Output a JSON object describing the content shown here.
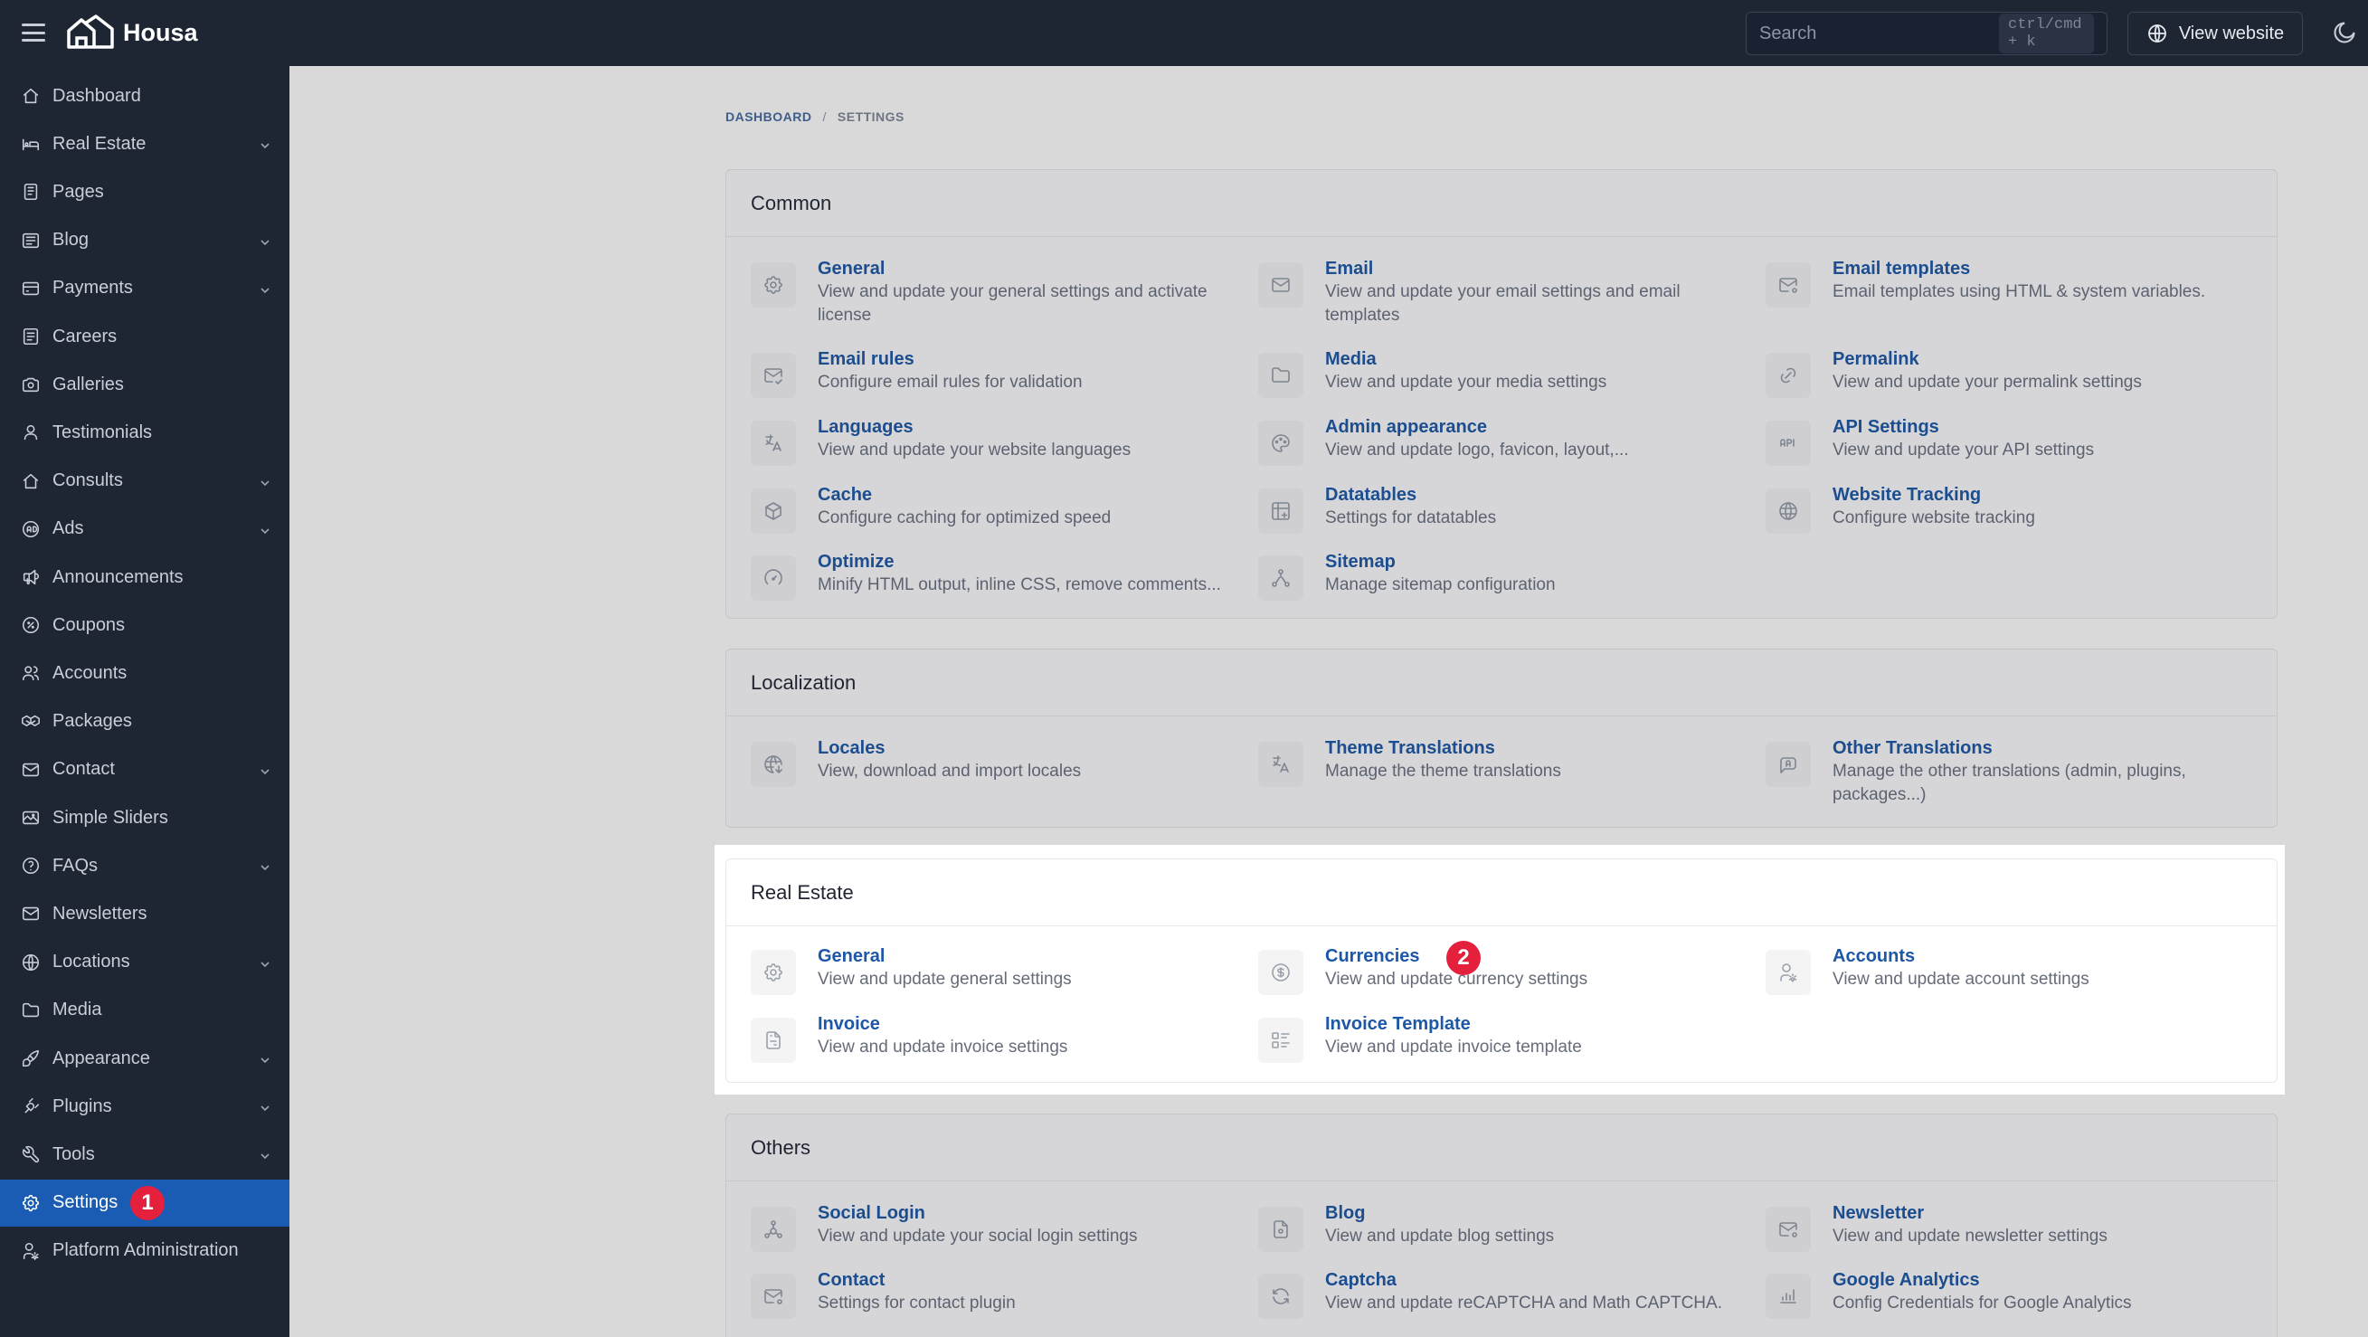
{
  "app": {
    "brand": "Housa"
  },
  "topbar": {
    "search_placeholder": "Search",
    "search_shortcut": "ctrl/cmd + k",
    "view_website_label": "View website"
  },
  "sidebar": {
    "items": [
      {
        "label": "Dashboard",
        "icon": "home-icon",
        "chevron": false
      },
      {
        "label": "Real Estate",
        "icon": "bed-icon",
        "chevron": true
      },
      {
        "label": "Pages",
        "icon": "page-icon",
        "chevron": false
      },
      {
        "label": "Blog",
        "icon": "article-icon",
        "chevron": true
      },
      {
        "label": "Payments",
        "icon": "credit-card-icon",
        "chevron": true
      },
      {
        "label": "Careers",
        "icon": "careers-icon",
        "chevron": false
      },
      {
        "label": "Galleries",
        "icon": "camera-icon",
        "chevron": false
      },
      {
        "label": "Testimonials",
        "icon": "user-icon",
        "chevron": false
      },
      {
        "label": "Consults",
        "icon": "home-icon",
        "chevron": true
      },
      {
        "label": "Ads",
        "icon": "ad-icon",
        "chevron": true
      },
      {
        "label": "Announcements",
        "icon": "speakerphone-icon",
        "chevron": false
      },
      {
        "label": "Coupons",
        "icon": "discount-icon",
        "chevron": false
      },
      {
        "label": "Accounts",
        "icon": "users-icon",
        "chevron": false
      },
      {
        "label": "Packages",
        "icon": "packages-icon",
        "chevron": false
      },
      {
        "label": "Contact",
        "icon": "mail-icon",
        "chevron": true
      },
      {
        "label": "Simple Sliders",
        "icon": "slider-icon",
        "chevron": false
      },
      {
        "label": "FAQs",
        "icon": "help-icon",
        "chevron": true
      },
      {
        "label": "Newsletters",
        "icon": "mail-icon",
        "chevron": false
      },
      {
        "label": "Locations",
        "icon": "globe-icon",
        "chevron": true
      },
      {
        "label": "Media",
        "icon": "folder-icon",
        "chevron": false
      },
      {
        "label": "Appearance",
        "icon": "brush-icon",
        "chevron": true
      },
      {
        "label": "Plugins",
        "icon": "plug-icon",
        "chevron": true
      },
      {
        "label": "Tools",
        "icon": "tool-icon",
        "chevron": true
      },
      {
        "label": "Settings",
        "icon": "settings-icon",
        "chevron": false,
        "active": true,
        "badge": "1"
      },
      {
        "label": "Platform Administration",
        "icon": "user-cog-icon",
        "chevron": false
      }
    ]
  },
  "breadcrumb": {
    "parent": "DASHBOARD",
    "separator": "/",
    "current": "SETTINGS"
  },
  "sections": {
    "common": {
      "title": "Common",
      "items": [
        {
          "title": "General",
          "desc": "View and update your general settings and activate license",
          "icon": "settings-icon"
        },
        {
          "title": "Email",
          "desc": "View and update your email settings and email templates",
          "icon": "mail-icon"
        },
        {
          "title": "Email templates",
          "desc": "Email templates using HTML & system variables.",
          "icon": "mail-cog-icon"
        },
        {
          "title": "Email rules",
          "desc": "Configure email rules for validation",
          "icon": "mail-check-icon"
        },
        {
          "title": "Media",
          "desc": "View and update your media settings",
          "icon": "folder-icon"
        },
        {
          "title": "Permalink",
          "desc": "View and update your permalink settings",
          "icon": "link-icon"
        },
        {
          "title": "Languages",
          "desc": "View and update your website languages",
          "icon": "language-icon"
        },
        {
          "title": "Admin appearance",
          "desc": "View and update logo, favicon, layout,...",
          "icon": "palette-icon"
        },
        {
          "title": "API Settings",
          "desc": "View and update your API settings",
          "icon": "api-icon"
        },
        {
          "title": "Cache",
          "desc": "Configure caching for optimized speed",
          "icon": "box-icon"
        },
        {
          "title": "Datatables",
          "desc": "Settings for datatables",
          "icon": "table-icon"
        },
        {
          "title": "Website Tracking",
          "desc": "Configure website tracking",
          "icon": "world-icon"
        },
        {
          "title": "Optimize",
          "desc": "Minify HTML output, inline CSS, remove comments...",
          "icon": "gauge-icon"
        },
        {
          "title": "Sitemap",
          "desc": "Manage sitemap configuration",
          "icon": "sitemap-icon"
        }
      ]
    },
    "localization": {
      "title": "Localization",
      "items": [
        {
          "title": "Locales",
          "desc": "View, download and import locales",
          "icon": "world-download-icon"
        },
        {
          "title": "Theme Translations",
          "desc": "Manage the theme translations",
          "icon": "language-icon"
        },
        {
          "title": "Other Translations",
          "desc": "Manage the other translations (admin, plugins, packages...)",
          "icon": "message-language-icon"
        }
      ]
    },
    "real_estate": {
      "title": "Real Estate",
      "items": [
        {
          "title": "General",
          "desc": "View and update general settings",
          "icon": "settings-icon"
        },
        {
          "title": "Currencies",
          "desc": "View and update currency settings",
          "icon": "currency-icon",
          "badge": "2"
        },
        {
          "title": "Accounts",
          "desc": "View and update account settings",
          "icon": "user-cog-icon"
        },
        {
          "title": "Invoice",
          "desc": "View and update invoice settings",
          "icon": "file-invoice-icon"
        },
        {
          "title": "Invoice Template",
          "desc": "View and update invoice template",
          "icon": "list-details-icon"
        }
      ]
    },
    "others": {
      "title": "Others",
      "items": [
        {
          "title": "Social Login",
          "desc": "View and update your social login settings",
          "icon": "social-icon"
        },
        {
          "title": "Blog",
          "desc": "View and update blog settings",
          "icon": "file-settings-icon"
        },
        {
          "title": "Newsletter",
          "desc": "View and update newsletter settings",
          "icon": "mail-cog-icon"
        },
        {
          "title": "Contact",
          "desc": "Settings for contact plugin",
          "icon": "mail-cog-icon"
        },
        {
          "title": "Captcha",
          "desc": "View and update reCAPTCHA and Math CAPTCHA.",
          "icon": "refresh-icon"
        },
        {
          "title": "Google Analytics",
          "desc": "Config Credentials for Google Analytics",
          "icon": "chart-icon"
        }
      ]
    }
  }
}
